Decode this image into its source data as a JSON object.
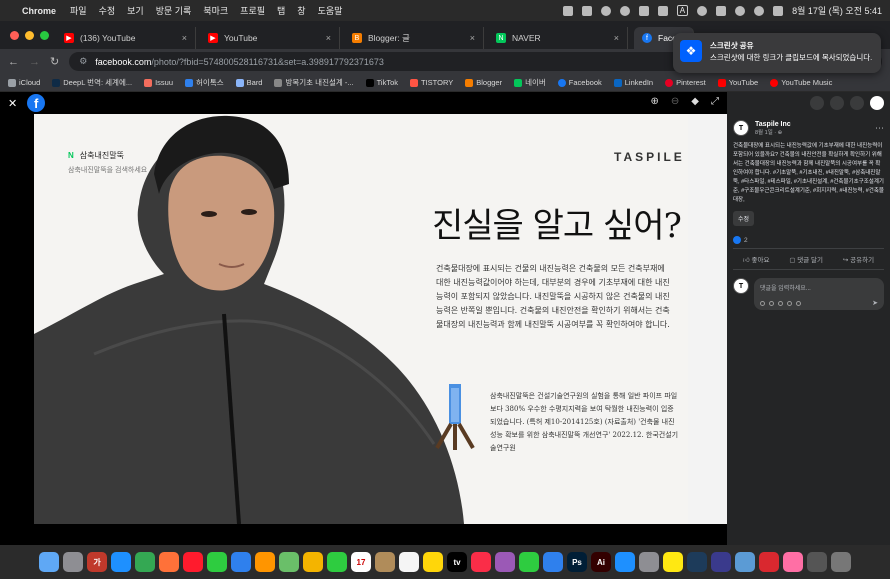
{
  "menubar": {
    "app": "Chrome",
    "items": [
      "파일",
      "수정",
      "보기",
      "방문 기록",
      "북마크",
      "프로필",
      "탭",
      "창",
      "도움말"
    ],
    "input_mode": "A",
    "datetime": "8월 17일 (목) 오전 5:41"
  },
  "tabs": [
    {
      "title": "(136) YouTube",
      "favicon": "youtube-icon",
      "color": "#ff0000"
    },
    {
      "title": "YouTube",
      "favicon": "youtube-icon",
      "color": "#ff0000"
    },
    {
      "title": "Blogger: 글",
      "favicon": "blogger-icon",
      "color": "#f57d00"
    },
    {
      "title": "NAVER",
      "favicon": "naver-icon",
      "color": "#03c75a"
    },
    {
      "title": "Facel",
      "favicon": "facebook-icon",
      "color": "#1877f2"
    }
  ],
  "address": {
    "host": "facebook.com",
    "path": "/photo/?fbid=574800528116731&set=a.398917792371673"
  },
  "bookmarks": [
    {
      "label": "iCloud",
      "color": "#9aa0a6"
    },
    {
      "label": "DeepL 번역: 세계에...",
      "color": "#0f2b46"
    },
    {
      "label": "Issuu",
      "color": "#f36d5d"
    },
    {
      "label": "허이톡스",
      "color": "#2f80ed"
    },
    {
      "label": "Bard",
      "color": "#8ab4f8"
    },
    {
      "label": "방목기초 내진설계 -...",
      "color": "#888888"
    },
    {
      "label": "TikTok",
      "color": "#000000"
    },
    {
      "label": "TISTORY",
      "color": "#ff5544"
    },
    {
      "label": "Blogger",
      "color": "#f57d00"
    },
    {
      "label": "네이버",
      "color": "#03c75a"
    },
    {
      "label": "Facebook",
      "color": "#1877f2"
    },
    {
      "label": "LinkedIn",
      "color": "#0a66c2"
    },
    {
      "label": "Pinterest",
      "color": "#e60023"
    },
    {
      "label": "YouTube",
      "color": "#ff0000"
    },
    {
      "label": "YouTube Music",
      "color": "#ff0000"
    }
  ],
  "notification": {
    "title": "스크린샷 공유",
    "message": "스크린샷에 대한 링크가 클립보드에 복사되었습니다."
  },
  "ad": {
    "brand_label": "삼축내진말뚝",
    "brand_sub": "삼축내진말뚝을 검색하세요",
    "logo": "TASPILE",
    "headline": "진실을 알고 싶어?",
    "paragraph1": "건축물대장에 표시되는 건물의 내진능력은 건축물의 모든 건축부재에 대한 내진능력값이어야 하는데, 대부분의 경우에 기초부재에 대한 내진능력이 포함되지 않았습니다. 내진말뚝을 시공하지 않은 건축물의 내진능력은 반쪽일 뿐입니다. 건축물의 내진안전을 확인하기 위해서는 건축물대장의 내진능력과 함께 내진말뚝 시공여부를 꼭 확인하여야 합니다.",
    "paragraph2": "삼축내진말뚝은 건설기술연구원의 실험을 통해 일반 파이프 파일보다 380% 우수한 수평지지력을 보여 탁월한 내진능력이 입증되었습니다. (특허 제10-2014125호) (자료출처) '건축물 내진성능 확보를 위한 삼축내진말뚝 개선연구' 2022.12. 한국건설기술연구원"
  },
  "post": {
    "page": "Taspile Inc",
    "time": "8월 1일 · ",
    "body": "건축물대장에 표시되는 내진능력값에 기초부재에 대한 내진능력이 포함되어 있을까요? 건축물의 내진안전을 확실하게 확인하기 위해서는 건축물대장의 내진능력과 함께 내진말뚝의 시공여부를 꼭 확인하여야 합니다. #기초말뚝, #기초내진, #내진말뚝, #삼축내진말뚝, #타스파일, #테스파일, #기초내진설계, #건축물기초구조설계기준, #구조물우근콘크리트설계기준, #회지지력, #내진능력, #건축물대장,",
    "edit_label": "수정",
    "like_count": "2",
    "actions": [
      "좋아요",
      "댓글 달기",
      "공유하기"
    ],
    "comment_placeholder": "댓글을 입력하세요..."
  },
  "dock": [
    {
      "name": "finder-icon",
      "color": "#5fa8f5",
      "glyph": ""
    },
    {
      "name": "launchpad-icon",
      "color": "#8e8e93",
      "glyph": ""
    },
    {
      "name": "dictionary-icon",
      "color": "#c0392b",
      "glyph": "가"
    },
    {
      "name": "safari-icon",
      "color": "#1e90ff",
      "glyph": ""
    },
    {
      "name": "chrome-icon",
      "color": "#34a853",
      "glyph": ""
    },
    {
      "name": "firefox-icon",
      "color": "#ff7139",
      "glyph": ""
    },
    {
      "name": "opera-icon",
      "color": "#ff1b2d",
      "glyph": ""
    },
    {
      "name": "messages-icon",
      "color": "#2ecc40",
      "glyph": ""
    },
    {
      "name": "mail-icon",
      "color": "#2f80ed",
      "glyph": ""
    },
    {
      "name": "books-icon",
      "color": "#ff9500",
      "glyph": ""
    },
    {
      "name": "maps-icon",
      "color": "#6abf69",
      "glyph": ""
    },
    {
      "name": "photos-icon",
      "color": "#f4b400",
      "glyph": ""
    },
    {
      "name": "facetime-icon",
      "color": "#2ecc40",
      "glyph": ""
    },
    {
      "name": "calendar-icon",
      "color": "#ffffff",
      "glyph": "17"
    },
    {
      "name": "contacts-icon",
      "color": "#b08c5a",
      "glyph": ""
    },
    {
      "name": "reminders-icon",
      "color": "#f5f5f5",
      "glyph": ""
    },
    {
      "name": "notes-icon",
      "color": "#ffd60a",
      "glyph": ""
    },
    {
      "name": "appletv-icon",
      "color": "#000000",
      "glyph": "tv"
    },
    {
      "name": "music-icon",
      "color": "#fa2d48",
      "glyph": ""
    },
    {
      "name": "podcasts-icon",
      "color": "#9b59b6",
      "glyph": ""
    },
    {
      "name": "numbers-icon",
      "color": "#2ecc40",
      "glyph": ""
    },
    {
      "name": "keynote-icon",
      "color": "#2f80ed",
      "glyph": ""
    },
    {
      "name": "photoshop-icon",
      "color": "#001e36",
      "glyph": "Ps"
    },
    {
      "name": "illustrator-icon",
      "color": "#330000",
      "glyph": "Ai"
    },
    {
      "name": "appstore-icon",
      "color": "#1e90ff",
      "glyph": ""
    },
    {
      "name": "settings-icon",
      "color": "#8e8e93",
      "glyph": ""
    },
    {
      "name": "kakaotalk-icon",
      "color": "#ffe812",
      "glyph": ""
    },
    {
      "name": "app-icon-1",
      "color": "#1d3b5a",
      "glyph": ""
    },
    {
      "name": "app-icon-2",
      "color": "#3a3a8c",
      "glyph": ""
    },
    {
      "name": "preview-icon",
      "color": "#5b9bd5",
      "glyph": ""
    },
    {
      "name": "acrobat-icon",
      "color": "#d9282f",
      "glyph": ""
    },
    {
      "name": "app-icon-3",
      "color": "#ff6fa5",
      "glyph": ""
    },
    {
      "name": "downloads-icon",
      "color": "#555555",
      "glyph": ""
    },
    {
      "name": "trash-icon",
      "color": "#777777",
      "glyph": ""
    }
  ]
}
